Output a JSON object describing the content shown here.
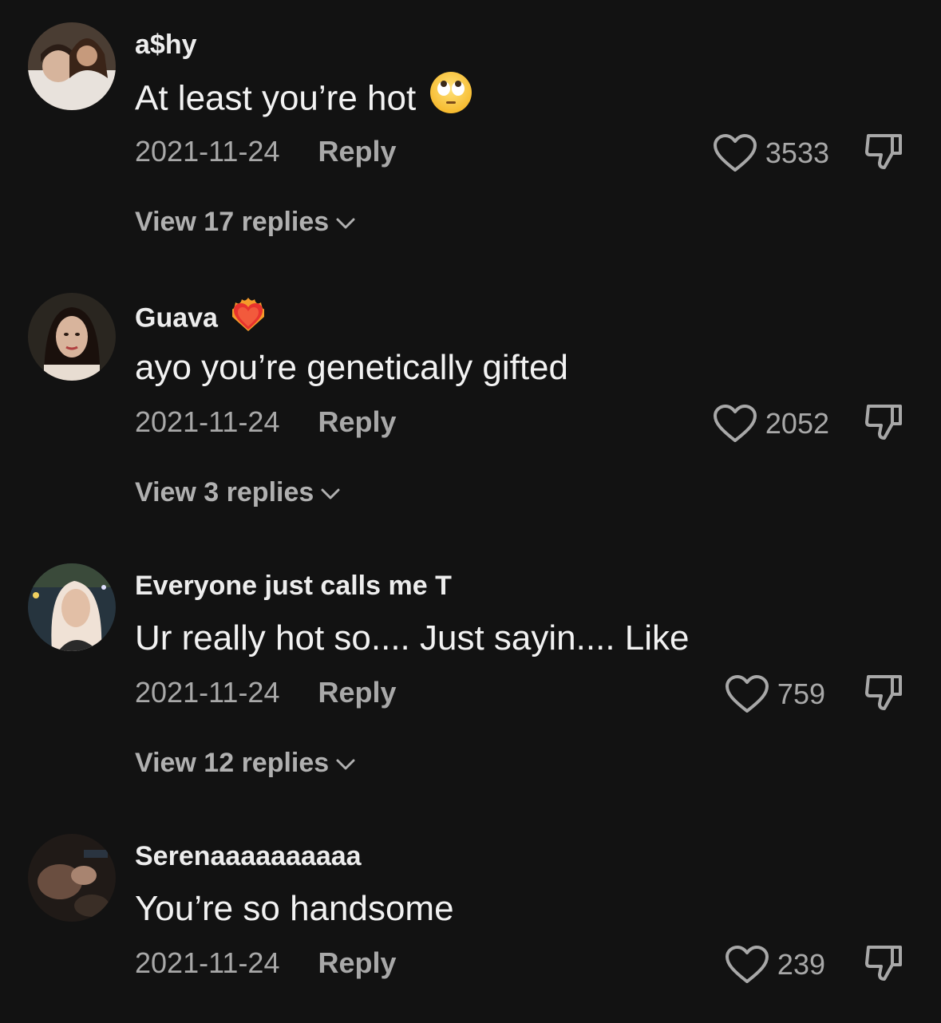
{
  "comments": [
    {
      "username": "a$hy",
      "username_emoji": "",
      "text": "At least you’re hot",
      "text_emoji": "face-with-rolling-eyes",
      "date": "2021-11-24",
      "reply_label": "Reply",
      "likes": "3533",
      "view_replies": "View 17 replies",
      "avatar_colors": [
        "#5a4a3e",
        "#d9c4b0",
        "#3b2b22"
      ]
    },
    {
      "username": "Guava",
      "username_emoji": "heart-on-fire",
      "text": "ayo you’re genetically gifted",
      "text_emoji": "",
      "date": "2021-11-24",
      "reply_label": "Reply",
      "likes": "2052",
      "view_replies": "View 3 replies",
      "avatar_colors": [
        "#1e1a17",
        "#d6b29a",
        "#2a1a12"
      ]
    },
    {
      "username": "Everyone just calls me T",
      "username_emoji": "",
      "text": "Ur really hot so.... Just sayin.... Like",
      "text_emoji": "",
      "date": "2021-11-24",
      "reply_label": "Reply",
      "likes": "759",
      "view_replies": "View 12 replies",
      "avatar_colors": [
        "#2c3a44",
        "#eacdb8",
        "#f4e6dc"
      ]
    },
    {
      "username": "Serenaaaaaaaaaa",
      "username_emoji": "",
      "text": "You’re so handsome",
      "text_emoji": "",
      "date": "2021-11-24",
      "reply_label": "Reply",
      "likes": "239",
      "view_replies": "",
      "avatar_colors": [
        "#2a221e",
        "#8a6a5a",
        "#1a1614"
      ]
    }
  ],
  "colors": {
    "background": "#121212",
    "text_primary": "#f2f2f2",
    "text_secondary": "#a8a8a8"
  },
  "icons": {
    "like": "heart-outline-icon",
    "dislike": "thumbs-down-outline-icon",
    "expand": "chevron-down-icon"
  }
}
